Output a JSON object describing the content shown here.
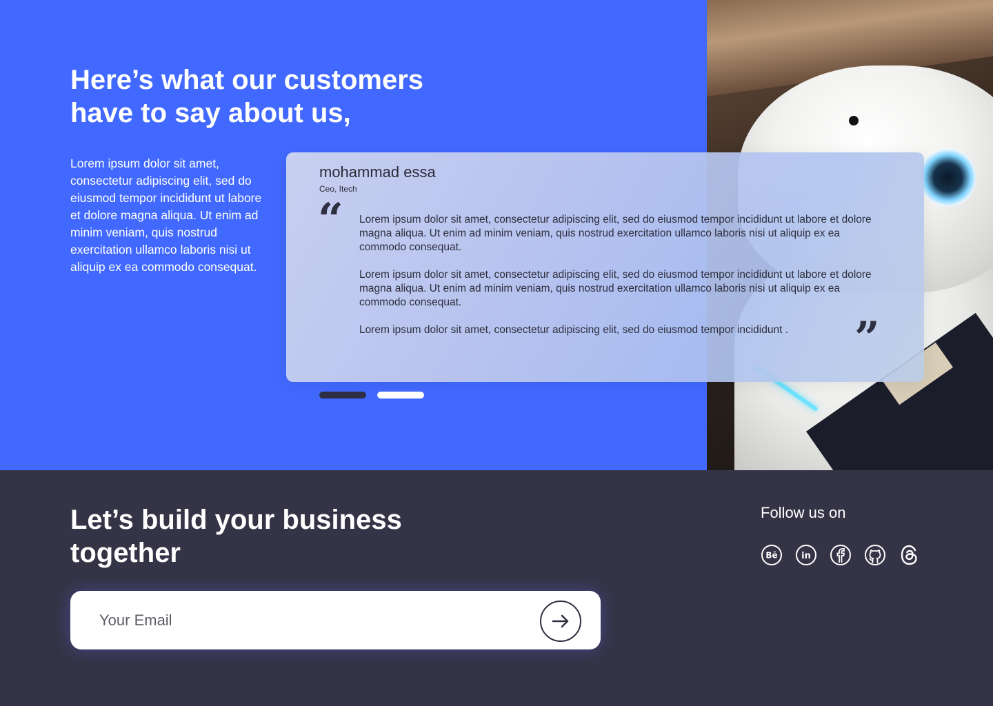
{
  "hero": {
    "title_line1": "Here’s what our customers",
    "title_line2": "have to say about us,",
    "description": "Lorem ipsum dolor sit amet, consectetur adipiscing elit, sed do eiusmod tempor incididunt ut labore et dolore magna aliqua. Ut enim ad minim veniam, quis nostrud exercitation ullamco laboris nisi ut aliquip ex ea commodo consequat.",
    "background_color": "#4169ff"
  },
  "testimonial": {
    "name": "mohammad essa",
    "role": "Ceo, Itech",
    "quote_open": "“",
    "quote_close": "”",
    "paragraphs": [
      "Lorem ipsum dolor sit amet, consectetur adipiscing elit, sed do eiusmod tempor incididunt ut labore et dolore magna aliqua. Ut enim ad minim veniam, quis nostrud exercitation ullamco laboris nisi ut aliquip ex ea commodo consequat.",
      "Lorem ipsum dolor sit amet, consectetur adipiscing elit, sed do eiusmod tempor incididunt ut labore et dolore magna aliqua. Ut enim ad minim veniam, quis nostrud exercitation ullamco laboris nisi ut aliquip ex ea commodo consequat.",
      "Lorem ipsum dolor sit amet, consectetur adipiscing elit, sed do eiusmod tempor incididunt ."
    ]
  },
  "carousel": {
    "active_index": 0,
    "count": 2,
    "active_color": "#2e2f45",
    "inactive_color": "#ffffff"
  },
  "footer": {
    "title_line1": "Let’s build your business",
    "title_line2": "together",
    "email_placeholder": "Your Email",
    "follow_label": "Follow us on",
    "background_color": "#353446",
    "socials": [
      "behance-icon",
      "linkedin-icon",
      "facebook-icon",
      "github-icon",
      "threads-icon"
    ]
  }
}
